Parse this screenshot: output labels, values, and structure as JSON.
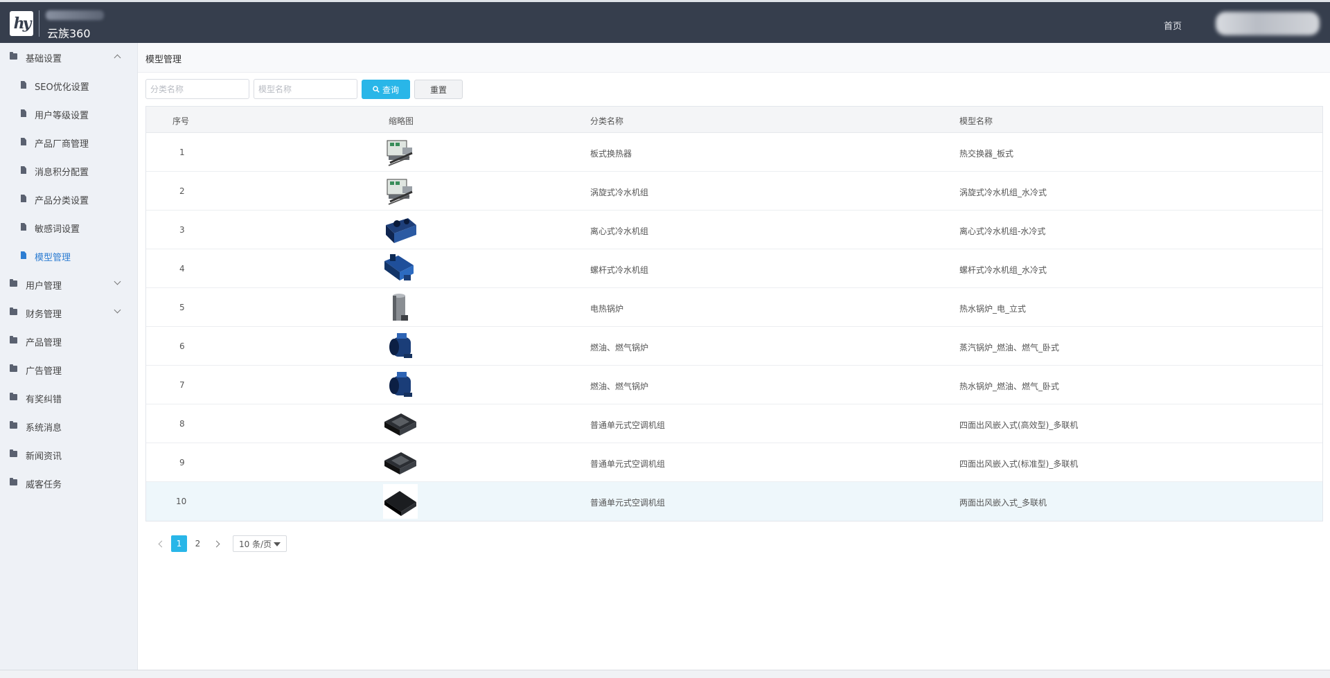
{
  "header": {
    "brand": "云族360",
    "home_link": "首页",
    "logo_glyph": "hy"
  },
  "sidebar": {
    "groups": [
      {
        "label": "基础设置",
        "expanded": true,
        "icon": "folder-icon"
      },
      {
        "label": "用户管理",
        "expanded": false,
        "icon": "folder-icon"
      },
      {
        "label": "财务管理",
        "expanded": false,
        "icon": "folder-icon"
      },
      {
        "label": "产品管理",
        "icon": "folder-icon"
      },
      {
        "label": "广告管理",
        "icon": "folder-icon"
      },
      {
        "label": "有奖纠错",
        "icon": "folder-icon"
      },
      {
        "label": "系统消息",
        "icon": "folder-icon"
      },
      {
        "label": "新闻资讯",
        "icon": "folder-icon"
      },
      {
        "label": "威客任务",
        "icon": "folder-icon"
      }
    ],
    "sub_items": [
      {
        "label": "SEO优化设置"
      },
      {
        "label": "用户等级设置"
      },
      {
        "label": "产品厂商管理"
      },
      {
        "label": "消息积分配置"
      },
      {
        "label": "产品分类设置"
      },
      {
        "label": "敏感词设置"
      },
      {
        "label": "模型管理",
        "active": true
      }
    ]
  },
  "breadcrumb": {
    "title": "模型管理"
  },
  "search": {
    "category_placeholder": "分类名称",
    "model_placeholder": "模型名称",
    "query_label": "查询",
    "reset_label": "重置"
  },
  "table": {
    "headers": [
      "序号",
      "缩略图",
      "分类名称",
      "模型名称"
    ],
    "rows": [
      {
        "index": "1",
        "thumb": "plate-heat-exchanger",
        "category": "板式换热器",
        "model": "热交换器_板式"
      },
      {
        "index": "2",
        "thumb": "scroll-chiller",
        "category": "涡旋式冷水机组",
        "model": "涡旋式冷水机组_水冷式"
      },
      {
        "index": "3",
        "thumb": "centrifugal-chiller",
        "category": "离心式冷水机组",
        "model": "离心式冷水机组-水冷式"
      },
      {
        "index": "4",
        "thumb": "screw-chiller",
        "category": "螺杆式冷水机组",
        "model": "螺杆式冷水机组_水冷式"
      },
      {
        "index": "5",
        "thumb": "electric-boiler",
        "category": "电热锅炉",
        "model": "热水锅炉_电_立式"
      },
      {
        "index": "6",
        "thumb": "oil-gas-boiler",
        "category": "燃油、燃气锅炉",
        "model": "蒸汽锅炉_燃油、燃气_卧式"
      },
      {
        "index": "7",
        "thumb": "oil-gas-boiler",
        "category": "燃油、燃气锅炉",
        "model": "热水锅炉_燃油、燃气_卧式"
      },
      {
        "index": "8",
        "thumb": "cassette-ac",
        "category": "普通单元式空调机组",
        "model": "四面出风嵌入式(高效型)_多联机"
      },
      {
        "index": "9",
        "thumb": "cassette-ac",
        "category": "普通单元式空调机组",
        "model": "四面出风嵌入式(标准型)_多联机"
      },
      {
        "index": "10",
        "thumb": "duct-ac",
        "category": "普通单元式空调机组",
        "model": "两面出风嵌入式_多联机"
      }
    ]
  },
  "pagination": {
    "pages": [
      "1",
      "2"
    ],
    "current": "1",
    "page_size_label": "10 条/页"
  },
  "colors": {
    "header_bg": "#363e4d",
    "accent": "#29b6e8",
    "active_link": "#2d7dd2",
    "sidebar_bg": "#eef1f6"
  }
}
